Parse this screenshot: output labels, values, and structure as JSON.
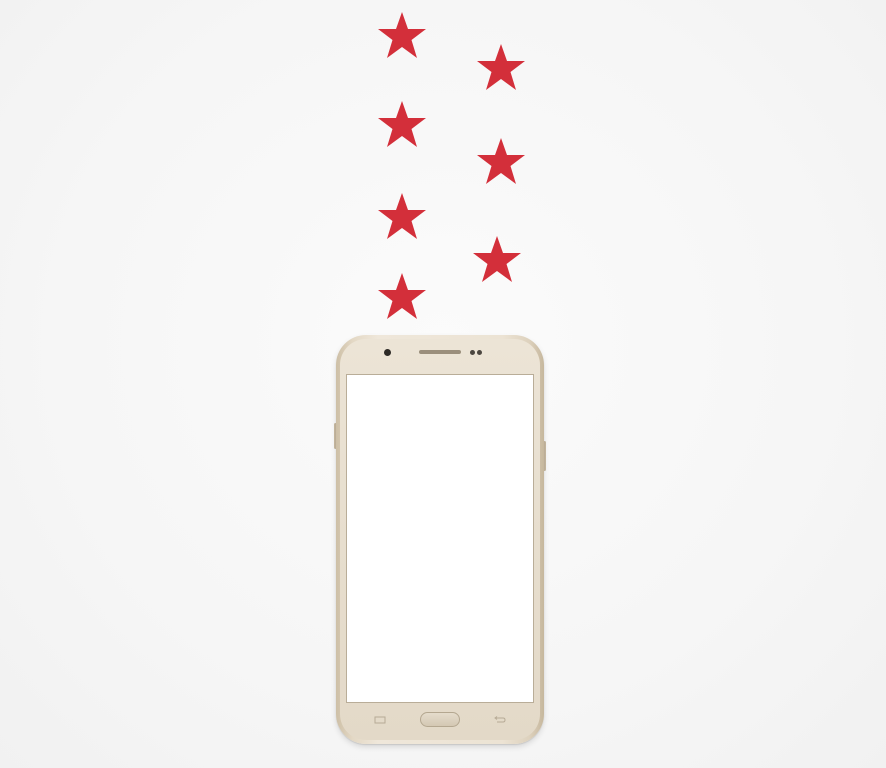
{
  "image": {
    "background_color": "#f7f7f7",
    "star_color": "#d32f3a",
    "star_count": 7,
    "stars": [
      {
        "name": "star-1"
      },
      {
        "name": "star-2"
      },
      {
        "name": "star-3"
      },
      {
        "name": "star-4"
      },
      {
        "name": "star-5"
      },
      {
        "name": "star-6"
      },
      {
        "name": "star-7"
      }
    ],
    "phone": {
      "color": "#e9e0d0",
      "screen_color": "#ffffff",
      "icons": [
        "camera-icon",
        "speaker-icon",
        "sensor-icon",
        "recent-apps-icon",
        "home-button",
        "back-icon"
      ]
    }
  }
}
